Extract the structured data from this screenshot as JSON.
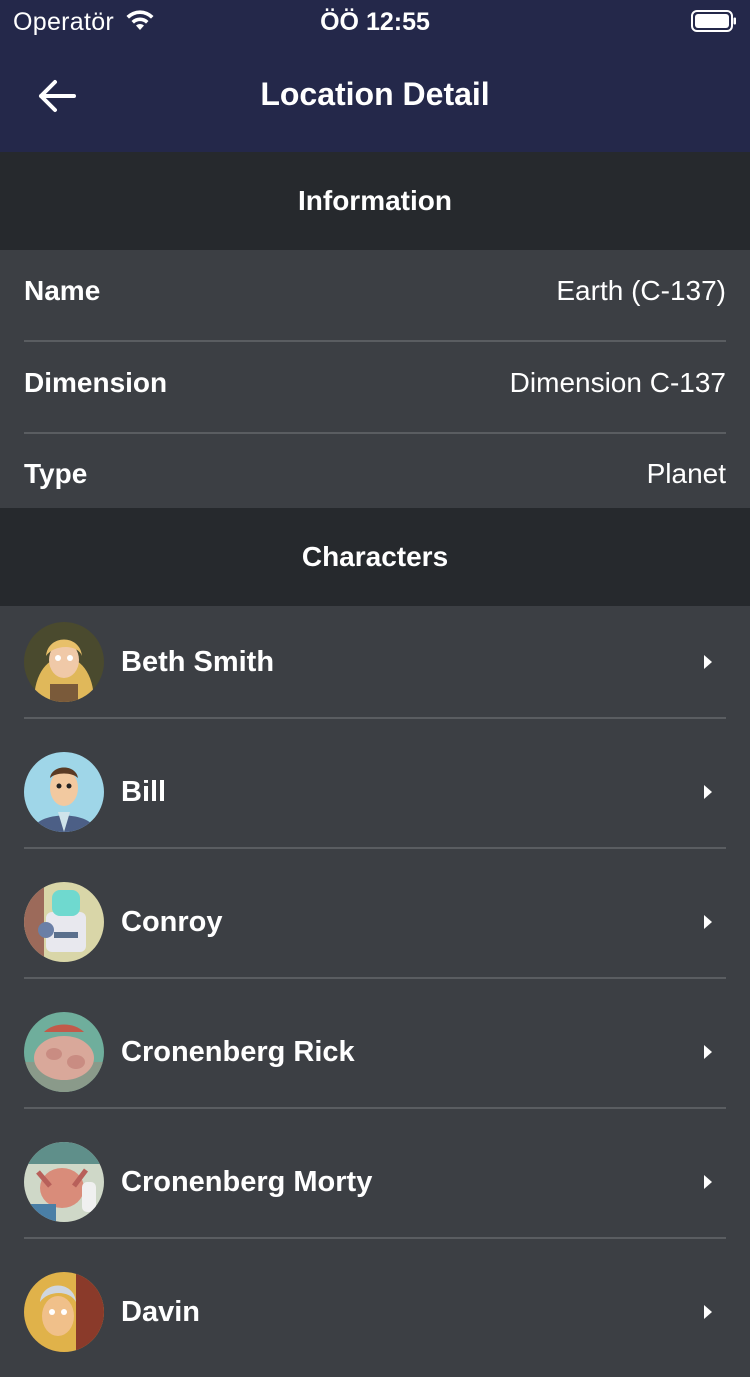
{
  "status_bar": {
    "carrier": "Operatör",
    "time": "ÖÖ 12:55"
  },
  "nav": {
    "title": "Location Detail",
    "back_icon": "arrow-left-icon"
  },
  "information": {
    "header": "Information",
    "rows": [
      {
        "label": "Name",
        "value": "Earth (C-137)"
      },
      {
        "label": "Dimension",
        "value": "Dimension C-137"
      },
      {
        "label": "Type",
        "value": "Planet"
      }
    ]
  },
  "characters": {
    "header": "Characters",
    "items": [
      {
        "name": "Beth Smith"
      },
      {
        "name": "Bill"
      },
      {
        "name": "Conroy"
      },
      {
        "name": "Cronenberg Rick"
      },
      {
        "name": "Cronenberg Morty"
      },
      {
        "name": "Davin"
      }
    ]
  },
  "colors": {
    "nav_background": "#24284a",
    "section_header_background": "#26292d",
    "body_background": "#3c3f44",
    "divider": "#5a5d61",
    "text": "#ffffff"
  }
}
